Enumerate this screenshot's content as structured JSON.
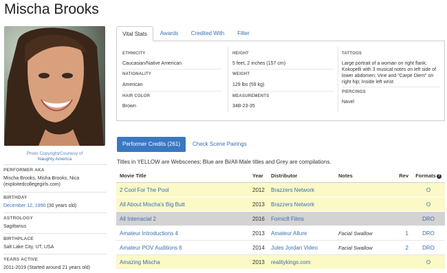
{
  "performer": {
    "name": "Mischa Brooks",
    "photo_credit_line1": "Photo Copyright/Courtesy of",
    "photo_credit_line2": "Naughty America"
  },
  "left_info": [
    {
      "label": "PERFORMER AKA",
      "value": "Mischa Brooks, Misha Brooks, Nica (exploitedcollegegirls.com)"
    },
    {
      "label": "BIRTHDAY",
      "value_link": "December 12, 1990",
      "value_extra": " (30 years old)"
    },
    {
      "label": "ASTROLOGY",
      "value_link": "Sagittarius"
    },
    {
      "label": "BIRTHPLACE",
      "value": "Salt Lake City, UT, USA"
    },
    {
      "label": "YEARS ACTIVE",
      "value": "2011-2019 (Started around 21 years old)"
    }
  ],
  "tabs": [
    {
      "label": "Vital Stats",
      "active": true
    },
    {
      "label": "Awards",
      "active": false
    },
    {
      "label": "Credited With",
      "active": false
    },
    {
      "label": "Filter",
      "active": false
    }
  ],
  "vital_stats": {
    "ethnicity_label": "ETHNICITY",
    "ethnicity": "Caucasian/Native American",
    "nationality_label": "NATIONALITY",
    "nationality": "American",
    "hair_label": "HAIR COLOR",
    "hair": "Brown",
    "height_label": "HEIGHT",
    "height": "5 feet, 2 inches (157 cm)",
    "weight_label": "WEIGHT",
    "weight": "129 lbs (59 kg)",
    "measurements_label": "MEASUREMENTS",
    "measurements": "34B-23-35",
    "tattoos_label": "TATTOOS",
    "tattoos": "Large portrait of a woman on right flank; Kokopelli with 3 musical notes on left side of lower abdomen; Vine and \"Carpe Diem\" on right hip; Inside left wrist",
    "piercings_label": "PIERCINGS",
    "piercings": "Navel"
  },
  "credits": {
    "performer_credits_button": "Performer Credits (261)",
    "scene_pairings_link": "Check Scene Pairings",
    "legend": "Titles in YELLOW are Webscenes; Blue are Bi/All-Male titles and Grey are compilations.",
    "columns": {
      "title": "Movie Title",
      "year": "Year",
      "distributor": "Distributor",
      "notes": "Notes",
      "rev": "Rev",
      "formats": "Formats"
    },
    "rows": [
      {
        "title": "2 Cool For The Pool",
        "year": "2012",
        "distributor": "Brazzers Network",
        "notes": "",
        "rev": "",
        "formats": "O",
        "style": "yellow"
      },
      {
        "title": "All About Mischa's Big Butt",
        "year": "2013",
        "distributor": "Brazzers Network",
        "notes": "",
        "rev": "",
        "formats": "O",
        "style": "yellow"
      },
      {
        "title": "All Interracial 2",
        "year": "2016",
        "distributor": "Fornic8 Films",
        "notes": "",
        "rev": "",
        "formats": "DRO",
        "style": "grey"
      },
      {
        "title": "Amateur Introductions 4",
        "year": "2013",
        "distributor": "Amateur Allure",
        "notes": "Facial Swallow",
        "rev": "1",
        "formats": "DRO",
        "style": "white"
      },
      {
        "title": "Amateur POV Auditions 6",
        "year": "2014",
        "distributor": "Jules Jordan Video",
        "notes": "Facial Swallow",
        "rev": "2",
        "formats": "DRO",
        "style": "white"
      },
      {
        "title": "Amazing Mischa",
        "year": "2013",
        "distributor": "realitykings.com",
        "notes": "",
        "rev": "",
        "formats": "O",
        "style": "yellow"
      }
    ]
  },
  "colors": {
    "link": "#3a6fb0",
    "button": "#3a78c3",
    "webscene_row": "#fbf9c6",
    "compilation_row": "#d3d3d3"
  }
}
